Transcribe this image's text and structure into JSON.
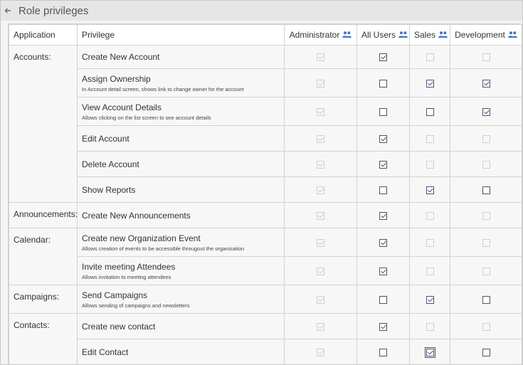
{
  "header": {
    "title": "Role privileges"
  },
  "columns": {
    "application": "Application",
    "privilege": "Privilege",
    "roles": [
      "Administrator",
      "All Users",
      "Sales",
      "Development"
    ]
  },
  "rows": [
    {
      "app": "Accounts:",
      "span": 6,
      "name": "Create New Account",
      "desc": "",
      "checks": [
        [
          true,
          true
        ],
        [
          true,
          false
        ],
        [
          false,
          true
        ],
        [
          false,
          true
        ]
      ]
    },
    {
      "app": "",
      "name": "Assign Ownership",
      "desc": "In Account detail screen, shows link to change owner for the account",
      "checks": [
        [
          true,
          true
        ],
        [
          false,
          false
        ],
        [
          true,
          false
        ],
        [
          true,
          false
        ]
      ]
    },
    {
      "app": "",
      "name": "View Account Details",
      "desc": "Allows clicking on the list screen to see account details",
      "checks": [
        [
          true,
          true
        ],
        [
          false,
          false
        ],
        [
          false,
          false
        ],
        [
          true,
          false
        ]
      ]
    },
    {
      "app": "",
      "name": "Edit Account",
      "desc": "",
      "checks": [
        [
          true,
          true
        ],
        [
          true,
          false
        ],
        [
          false,
          true
        ],
        [
          false,
          true
        ]
      ]
    },
    {
      "app": "",
      "name": "Delete Account",
      "desc": "",
      "checks": [
        [
          true,
          true
        ],
        [
          true,
          false
        ],
        [
          false,
          true
        ],
        [
          false,
          true
        ]
      ]
    },
    {
      "app": "",
      "name": "Show Reports",
      "desc": "",
      "checks": [
        [
          true,
          true
        ],
        [
          false,
          false
        ],
        [
          true,
          false
        ],
        [
          false,
          false
        ]
      ]
    },
    {
      "app": "Announcements:",
      "span": 1,
      "name": "Create New Announcements",
      "desc": "",
      "checks": [
        [
          true,
          true
        ],
        [
          true,
          false
        ],
        [
          false,
          true
        ],
        [
          false,
          true
        ]
      ]
    },
    {
      "app": "Calendar:",
      "span": 2,
      "name": "Create new Organization Event",
      "desc": "Allows creation of events to be accessible througout the organization",
      "checks": [
        [
          true,
          true
        ],
        [
          true,
          false
        ],
        [
          false,
          true
        ],
        [
          false,
          true
        ]
      ]
    },
    {
      "app": "",
      "name": "Invite meeting Attendees",
      "desc": "Allows invitation to meeting attendees",
      "checks": [
        [
          true,
          true
        ],
        [
          true,
          false
        ],
        [
          false,
          true
        ],
        [
          false,
          true
        ]
      ]
    },
    {
      "app": "Campaigns:",
      "span": 1,
      "name": "Send Campaigns",
      "desc": "Allows sending of campaigns and newsletters",
      "checks": [
        [
          true,
          true
        ],
        [
          false,
          false
        ],
        [
          true,
          false
        ],
        [
          false,
          false
        ]
      ]
    },
    {
      "app": "Contacts:",
      "span": 2,
      "name": "Create new contact",
      "desc": "",
      "checks": [
        [
          true,
          true
        ],
        [
          true,
          false
        ],
        [
          false,
          true
        ],
        [
          false,
          true
        ]
      ]
    },
    {
      "app": "",
      "name": "Edit Contact",
      "desc": "",
      "checks": [
        [
          true,
          true
        ],
        [
          false,
          false
        ],
        [
          true,
          false
        ],
        [
          false,
          false
        ]
      ]
    }
  ],
  "focused_check": {
    "row": 11,
    "col": 2
  },
  "colors": {
    "accent": "#1c5fb5",
    "role_icon": "#4472c4"
  }
}
